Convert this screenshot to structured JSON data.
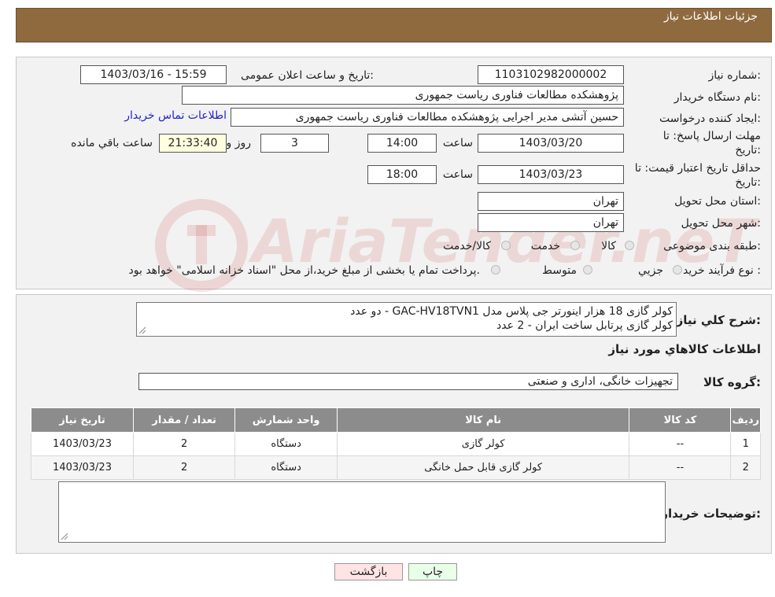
{
  "header": {
    "title": "جزئیات اطلاعات نیاز"
  },
  "form": {
    "need_number_label": "شماره نیاز:",
    "need_number": "1103102982000002",
    "announce_label": "تاریخ و ساعت اعلان عمومی:",
    "announce_value": "1403/03/16 - 15:59",
    "buyer_label": "نام دستگاه خریدار:",
    "buyer_value": "پژوهشکده مطالعات فناوری ریاست جمهوری",
    "creator_label": "ایجاد کننده درخواست:",
    "creator_value": "حسین آتشی مدیر اجرایی پژوهشکده مطالعات فناوری ریاست جمهوری",
    "contact_link": "اطلاعات تماس خریدار",
    "deadline_label_1": "مهلت ارسال پاسخ: تا",
    "deadline_label_2": "تاریخ:",
    "deadline_date": "1403/03/20",
    "time_label": "ساعت",
    "deadline_time": "14:00",
    "days_value": "3",
    "days_label": "روز و",
    "remaining_value": "21:33:40",
    "remaining_label": "ساعت باقي مانده",
    "validity_label_1": "حداقل تاریخ اعتبار قیمت: تا",
    "validity_label_2": "تاریخ:",
    "validity_date": "1403/03/23",
    "validity_time": "18:00",
    "province_label": "استان محل تحویل:",
    "province_value": "تهران",
    "city_label": "شهر محل تحویل:",
    "city_value": "تهران",
    "category_label": "طبقه بندی موضوعی:",
    "category_options": [
      "کالا",
      "خدمت",
      "کالا/خدمت"
    ],
    "process_label": "نوع فرآیند خرید :",
    "process_options": [
      "جزیي",
      "متوسط"
    ],
    "process_note": "پرداخت تمام یا بخشی از مبلغ خرید،از محل \"اسناد خزانه اسلامی\" خواهد بود."
  },
  "summary": {
    "label": "شرح کلي نياز:",
    "line1": "کولر گازی 18 هزار اینورتر جی پلاس مدل GAC-HV18TVN1 - دو عدد",
    "line2": "کولر گازی پرتابل ساخت ایران - 2 عدد"
  },
  "goods_info_title": "اطلاعات کالاهاي مورد نياز",
  "goods_group": {
    "label": "گروه کالا:",
    "value": "تجهیزات خانگی، اداری و صنعتی"
  },
  "table": {
    "headers": [
      "رديف",
      "کد کالا",
      "نام کالا",
      "واحد شمارش",
      "تعداد / مقدار",
      "تاریخ نیاز"
    ],
    "rows": [
      [
        "1",
        "--",
        "کولر گازی",
        "دستگاه",
        "2",
        "1403/03/23"
      ],
      [
        "2",
        "--",
        "کولر گازی قابل حمل خانگی",
        "دستگاه",
        "2",
        "1403/03/23"
      ]
    ]
  },
  "buyer_notes_label": "توضیحات خریدار:",
  "buttons": {
    "print": "چاپ",
    "back": "بازگشت"
  },
  "watermark": "AriaTender.neT",
  "colors": {
    "header": "#8f6a3f",
    "table_header": "#8c8c8c",
    "link": "#2222cc",
    "back_button": "#ffe4e4"
  }
}
